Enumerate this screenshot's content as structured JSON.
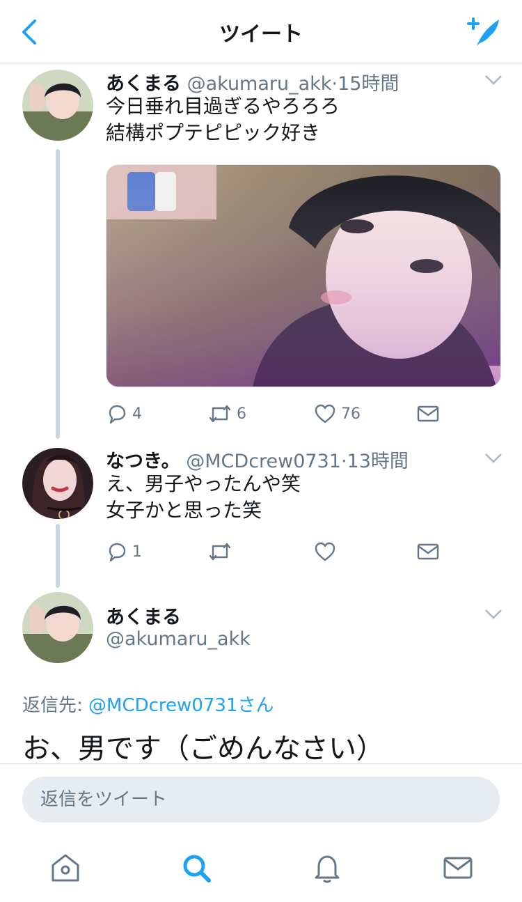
{
  "header": {
    "title": "ツイート",
    "back_icon": "chevron-left-icon",
    "compose_icon": "compose-tweet-icon",
    "accent": "#1da1f2"
  },
  "tweets": [
    {
      "name": "あくまる",
      "handle": "@akumaru_akk",
      "time": "·15時間",
      "lines": [
        "今日垂れ目過ぎるやろろろ",
        "結構ポプテピピック好き"
      ],
      "replies": "4",
      "retweets": "6",
      "likes": "76",
      "has_media": true
    },
    {
      "name": "なつき。",
      "handle": "@MCDcrew0731",
      "time": "·13時間",
      "lines": [
        "え、男子やったんや笑",
        "女子かと思った笑"
      ],
      "replies": "1",
      "retweets": "",
      "likes": ""
    }
  ],
  "composer": {
    "name": "あくまる",
    "handle": "@akumaru_akk",
    "reply_prefix": "返信先:",
    "reply_target": "@MCDcrew0731さん",
    "draft_text": "お、男です（ごめんなさい）",
    "input_placeholder": "返信をツイート"
  },
  "tabbar": {
    "items": [
      "home-icon",
      "search-icon",
      "notifications-icon",
      "messages-icon"
    ],
    "active": "search-icon"
  }
}
